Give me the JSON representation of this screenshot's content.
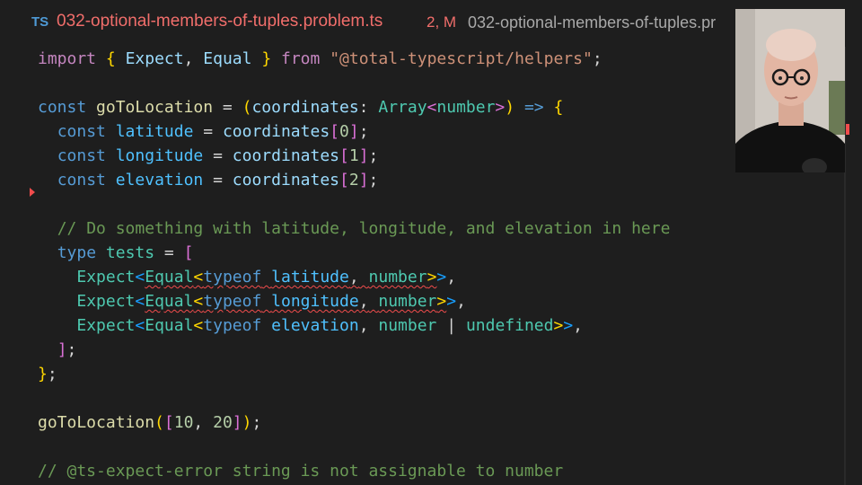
{
  "tab": {
    "lang_badge": "TS",
    "file_name": "032-optional-members-of-tuples.problem.ts",
    "status": "2, M",
    "breadcrumb": "032-optional-members-of-tuples.pr"
  },
  "code": {
    "l1_import": "import",
    "l1_ob": "{",
    "l1_expect": "Expect",
    "l1_comma": ",",
    "l1_equal": "Equal",
    "l1_cb": "}",
    "l1_from": "from",
    "l1_module": "\"@total-typescript/helpers\"",
    "l1_semi": ";",
    "l3_const": "const",
    "l3_name": "goToLocation",
    "l3_eq": "=",
    "l3_op": "(",
    "l3_param": "coordinates",
    "l3_colon": ":",
    "l3_array": "Array",
    "l3_lt": "<",
    "l3_number": "number",
    "l3_gt": ">",
    "l3_cp": ")",
    "l3_arrow": "=>",
    "l3_brace": "{",
    "l4_const": "const",
    "l4_name": "latitude",
    "l4_eq": "=",
    "l4_src": "coordinates",
    "l4_ob": "[",
    "l4_idx": "0",
    "l4_cb": "]",
    "l4_semi": ";",
    "l5_const": "const",
    "l5_name": "longitude",
    "l5_eq": "=",
    "l5_src": "coordinates",
    "l5_ob": "[",
    "l5_idx": "1",
    "l5_cb": "]",
    "l5_semi": ";",
    "l6_const": "const",
    "l6_name": "elevation",
    "l6_eq": "=",
    "l6_src": "coordinates",
    "l6_ob": "[",
    "l6_idx": "2",
    "l6_cb": "]",
    "l6_semi": ";",
    "l8_comment": "// Do something with latitude, longitude, and elevation in here",
    "l9_type": "type",
    "l9_name": "tests",
    "l9_eq": "=",
    "l9_ob": "[",
    "l10_expect": "Expect",
    "l10_lt1": "<",
    "l10_equal": "Equal",
    "l10_lt2": "<",
    "l10_typeof": "typeof",
    "l10_var": "latitude",
    "l10_comma": ",",
    "l10_number": "number",
    "l10_gt2": ">",
    "l10_gt1": ">",
    "l10_comma2": ",",
    "l11_expect": "Expect",
    "l11_lt1": "<",
    "l11_equal": "Equal",
    "l11_lt2": "<",
    "l11_typeof": "typeof",
    "l11_var": "longitude",
    "l11_comma": ",",
    "l11_number": "number",
    "l11_gt2": ">",
    "l11_gt1": ">",
    "l11_comma2": ",",
    "l12_expect": "Expect",
    "l12_lt1": "<",
    "l12_equal": "Equal",
    "l12_lt2": "<",
    "l12_typeof": "typeof",
    "l12_var": "elevation",
    "l12_comma": ",",
    "l12_number": "number",
    "l12_pipe": "|",
    "l12_undef": "undefined",
    "l12_gt2": ">",
    "l12_gt1": ">",
    "l12_comma2": ",",
    "l13_cb": "]",
    "l13_semi": ";",
    "l14_cb": "}",
    "l14_semi": ";",
    "l16_name": "goToLocation",
    "l16_op": "(",
    "l16_ob": "[",
    "l16_n1": "10",
    "l16_comma": ",",
    "l16_n2": "20",
    "l16_cb": "]",
    "l16_cp": ")",
    "l16_semi": ";",
    "l18_comment": "// @ts-expect-error string is not assignable to number"
  },
  "colors": {
    "background": "#1e1e1e",
    "error": "#f14c4c",
    "tab_modified": "#f16e6b",
    "ts_badge": "#4e9ad6"
  }
}
